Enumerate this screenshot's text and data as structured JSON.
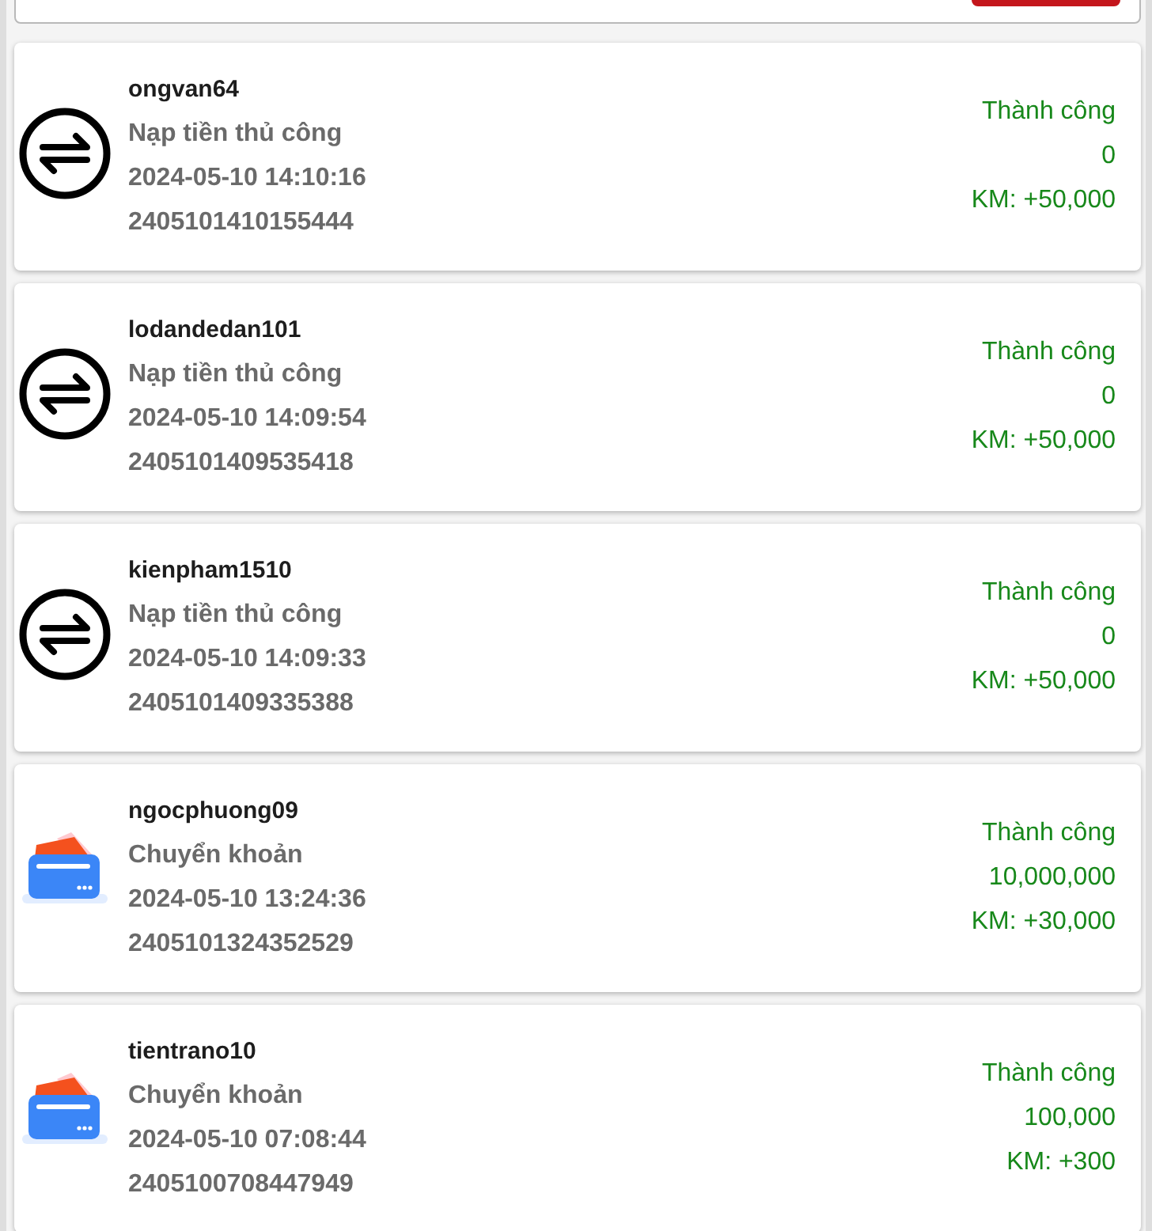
{
  "transactions": [
    {
      "kind": "manual",
      "username": "ongvan64",
      "method": "Nạp tiền thủ công",
      "time": "2024-05-10 14:10:16",
      "code": "2405101410155444",
      "status": "Thành công",
      "amount": "0",
      "bonus": "KM: +50,000"
    },
    {
      "kind": "manual",
      "username": "lodandedan101",
      "method": "Nạp tiền thủ công",
      "time": "2024-05-10 14:09:54",
      "code": "2405101409535418",
      "status": "Thành công",
      "amount": "0",
      "bonus": "KM: +50,000"
    },
    {
      "kind": "manual",
      "username": "kienpham1510",
      "method": "Nạp tiền thủ công",
      "time": "2024-05-10 14:09:33",
      "code": "2405101409335388",
      "status": "Thành công",
      "amount": "0",
      "bonus": "KM: +50,000"
    },
    {
      "kind": "transfer",
      "username": "ngocphuong09",
      "method": "Chuyển khoản",
      "time": "2024-05-10 13:24:36",
      "code": "2405101324352529",
      "status": "Thành công",
      "amount": "10,000,000",
      "bonus": "KM: +30,000"
    },
    {
      "kind": "transfer",
      "username": "tientrano10",
      "method": "Chuyển khoản",
      "time": "2024-05-10 07:08:44",
      "code": "2405100708447949",
      "status": "Thành công",
      "amount": "100,000",
      "bonus": "KM: +300"
    }
  ]
}
